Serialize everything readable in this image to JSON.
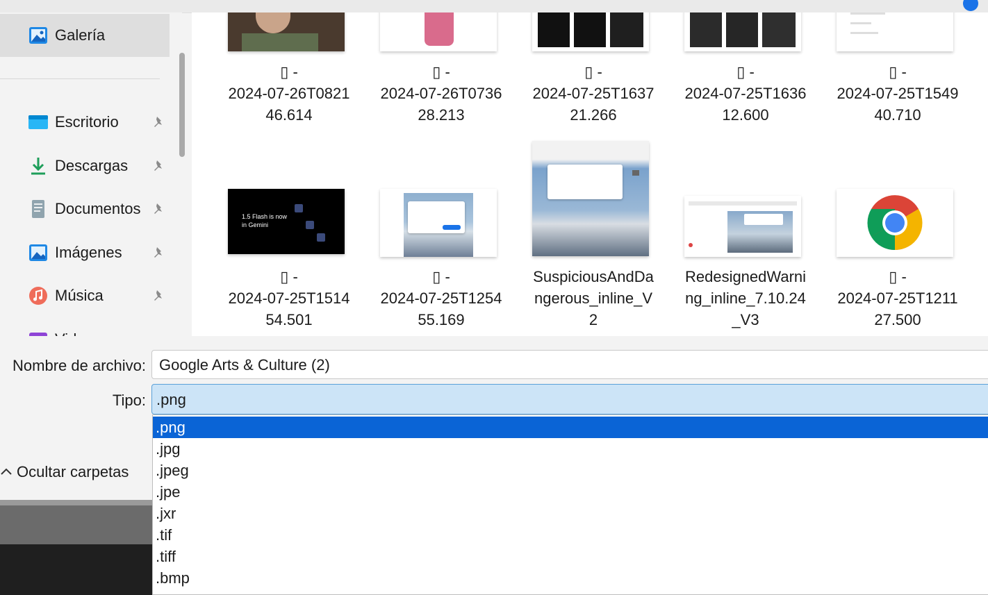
{
  "sidebar": {
    "items": [
      {
        "label": "Galería",
        "icon": "gallery-icon",
        "pinned": false,
        "selected": true
      },
      {
        "label": "Escritorio",
        "icon": "desktop-folder-icon",
        "pinned": true
      },
      {
        "label": "Descargas",
        "icon": "download-icon",
        "pinned": true
      },
      {
        "label": "Documentos",
        "icon": "document-icon",
        "pinned": true
      },
      {
        "label": "Imágenes",
        "icon": "pictures-icon",
        "pinned": true
      },
      {
        "label": "Música",
        "icon": "music-icon",
        "pinned": true
      },
      {
        "label": "Videos",
        "icon": "videos-icon",
        "pinned": true
      }
    ]
  },
  "files": {
    "row1": [
      {
        "line1": "▯ -",
        "line2": "2024-07-26T0821",
        "line3": "46.614"
      },
      {
        "line1": "▯ -",
        "line2": "2024-07-26T0736",
        "line3": "28.213"
      },
      {
        "line1": "▯ -",
        "line2": "2024-07-25T1637",
        "line3": "21.266"
      },
      {
        "line1": "▯ -",
        "line2": "2024-07-25T1636",
        "line3": "12.600"
      },
      {
        "line1": "▯ -",
        "line2": "2024-07-25T1549",
        "line3": "40.710"
      }
    ],
    "row2": [
      {
        "line1": "▯ -",
        "line2": "2024-07-25T1514",
        "line3": "54.501",
        "thumb_text": "1.5 Flash is now in Gemini"
      },
      {
        "line1": "▯ -",
        "line2": "2024-07-25T1254",
        "line3": "55.169"
      },
      {
        "line1": "SuspiciousAndDa",
        "line2": "ngerous_inline_V",
        "line3": "2"
      },
      {
        "line1": "RedesignedWarni",
        "line2": "ng_inline_7.10.24",
        "line3": "_V3"
      },
      {
        "line1": "▯ -",
        "line2": "2024-07-25T1211",
        "line3": "27.500"
      }
    ]
  },
  "filename": {
    "label": "Nombre de archivo:",
    "value": "Google Arts & Culture  (2)"
  },
  "filetype": {
    "label": "Tipo:",
    "value": ".png",
    "options": [
      ".png",
      ".jpg",
      ".jpeg",
      ".jpe",
      ".jxr",
      ".tif",
      ".tiff",
      ".bmp"
    ]
  },
  "hide_folders": {
    "label": "Ocultar carpetas"
  },
  "colors": {
    "selection": "#0a64d6",
    "select_bg": "#cce4f7",
    "sidebar_selected": "#dedede"
  }
}
